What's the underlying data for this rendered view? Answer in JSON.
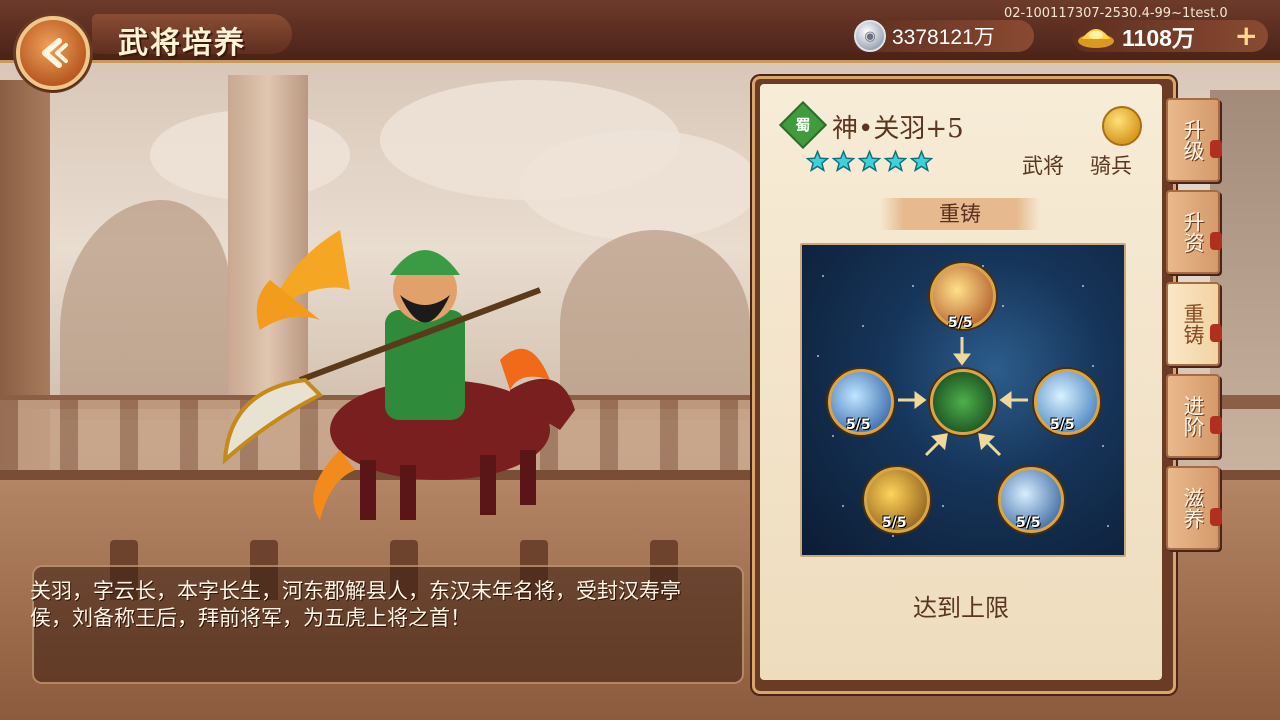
{
  "header": {
    "title": "武将培养",
    "build_id": "02-100117307-2530.4-99~1test.0",
    "silver_value": "3378121万",
    "gold_value": "1108万",
    "plus_label": "+"
  },
  "hero": {
    "faction": "蜀",
    "name": "神•关羽+5",
    "stars": 5,
    "role_type": "武将",
    "unit_type": "骑兵",
    "description": "关羽，字云长，本字长生，河东郡解县人，东汉末年名将，受封汉寿亭侯，刘备称王后，拜前将军，为五虎上将之首！"
  },
  "panel": {
    "section_label": "重铸",
    "limit_text": "达到上限",
    "skills": [
      {
        "name": "skill-top",
        "level": "5/5"
      },
      {
        "name": "skill-left",
        "level": "5/5"
      },
      {
        "name": "skill-right",
        "level": "5/5"
      },
      {
        "name": "skill-bottom-left",
        "level": "5/5"
      },
      {
        "name": "skill-bottom-right",
        "level": "5/5"
      }
    ]
  },
  "tabs": [
    {
      "label": "升级",
      "active": false
    },
    {
      "label": "升资",
      "active": false
    },
    {
      "label": "重铸",
      "active": true
    },
    {
      "label": "进阶",
      "active": false
    },
    {
      "label": "滋养",
      "active": false
    }
  ],
  "colors": {
    "star": "#3fd0d8",
    "faction_green": "#3f9b3c",
    "skill_ring": "#d9a645"
  }
}
